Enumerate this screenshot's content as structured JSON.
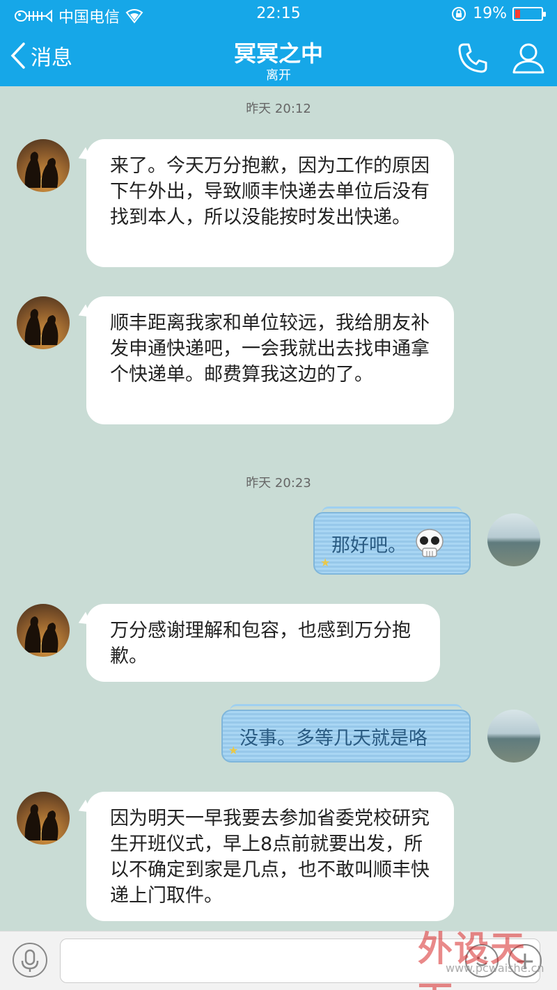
{
  "status_bar": {
    "carrier": "中国电信",
    "time": "22:15",
    "battery": "19%",
    "battery_level": 0.19,
    "battery_color": "#ff3b30"
  },
  "header": {
    "back_label": "消息",
    "title": "冥冥之中",
    "subtitle": "离开",
    "call_icon": "phone-icon",
    "profile_icon": "person-icon",
    "bg_color": "#16a7e8"
  },
  "messages": {
    "time_1": "昨天 20:12",
    "time_2": "昨天 20:23",
    "m1": "来了。今天万分抱歉，因为工作的原因下午外出，导致顺丰快递去单位后没有找到本人，所以没能按时发出快递。",
    "m2": "顺丰距离我家和单位较远，我给朋友补发申通快递吧，一会我就出去找申通拿个快递单。邮费算我这边的了。",
    "m3": "那好吧。",
    "m4": "万分感谢理解和包容，也感到万分抱歉。",
    "m5": "没事。多等几天就是咯",
    "m6": "因为明天一早我要去参加省委党校研究生开班仪式，早上8点前就要出发，所以不确定到家是几点，也不敢叫顺丰快递上门取件。"
  },
  "input_bar": {
    "mic_icon": "microphone-icon",
    "emoji_icon": "smiley-icon",
    "plus_icon": "plus-icon"
  },
  "watermark": {
    "text": "外设天下",
    "url": "www.pcwaishe.cn"
  }
}
